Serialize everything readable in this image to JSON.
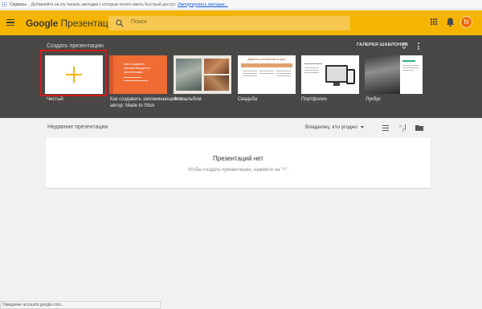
{
  "bookmarks": {
    "services_label": "Сервисы",
    "hint_text": "Добавляйте на эту панель закладки с которым хотите иметь быстрый доступ.",
    "import_link": "Импортировать закладки..."
  },
  "appbar": {
    "brand_google": "Google",
    "brand_product": "Презентации",
    "search_placeholder": "Поиск",
    "avatar_letter": "N",
    "icons": [
      "menu-icon",
      "search-icon",
      "apps-icon",
      "notifications-icon"
    ]
  },
  "templates": {
    "title": "Создать презентацию",
    "gallery_label": "ГАЛЕРЕЯ ШАБЛОНОВ",
    "items": [
      {
        "label": "Чистый",
        "sub": ""
      },
      {
        "label": "Как создавать запоминающиеся...",
        "sub": "автор: Made to Stick",
        "preview_title": "Как создавать запоминающиеся презентации"
      },
      {
        "label": "Фотоальбом",
        "sub": ""
      },
      {
        "label": "Свадьба",
        "sub": "",
        "preview_title": "Давайте устроим вам отпуск!"
      },
      {
        "label": "Портфолио",
        "sub": ""
      },
      {
        "label": "Лукбук",
        "sub": ""
      }
    ]
  },
  "recent": {
    "title": "Недавние презентации",
    "owner_filter": "Владелец: кто угодно",
    "empty_title": "Презентаций нет",
    "empty_hint": "Чтобы создать презентацию, нажмите на \"+\"."
  },
  "status": {
    "text": "Ожидание accounts.google.com..."
  },
  "colors": {
    "accent": "#f4b400",
    "panel": "#4a4846",
    "avatar": "#ef6c00",
    "selection": "#d31b1b"
  }
}
